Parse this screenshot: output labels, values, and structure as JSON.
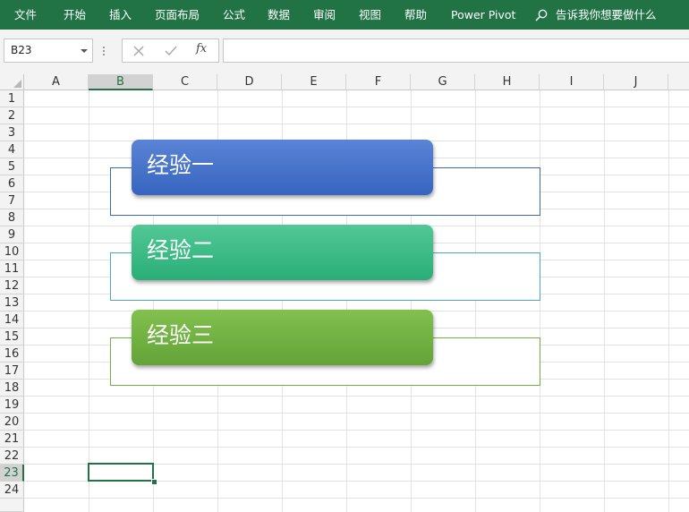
{
  "ribbon": {
    "tabs": [
      "文件",
      "开始",
      "插入",
      "页面布局",
      "公式",
      "数据",
      "审阅",
      "视图",
      "帮助",
      "Power Pivot"
    ],
    "tell_me": "告诉我你想要做什么"
  },
  "formula_bar": {
    "name_box": "B23",
    "cancel_icon": "cancel-icon",
    "enter_icon": "check-icon",
    "function_label": "fx",
    "formula": ""
  },
  "sheet": {
    "columns": [
      "A",
      "B",
      "C",
      "D",
      "E",
      "F",
      "G",
      "H",
      "I",
      "J"
    ],
    "rows": [
      "1",
      "2",
      "3",
      "4",
      "5",
      "6",
      "7",
      "8",
      "9",
      "10",
      "11",
      "12",
      "13",
      "14",
      "15",
      "16",
      "17",
      "18",
      "19",
      "20",
      "21",
      "22",
      "23",
      "24"
    ],
    "selected_column": "B",
    "selected_row": "23"
  },
  "shapes": [
    {
      "label": "经验一",
      "color_top": "#5b84d6",
      "color_bottom": "#3664bf",
      "outline": "#3a6ab0"
    },
    {
      "label": "经验二",
      "color_top": "#52c896",
      "color_bottom": "#2aae78",
      "outline": "#4aa8c0"
    },
    {
      "label": "经验三",
      "color_top": "#82c04e",
      "color_bottom": "#63a338",
      "outline": "#70ad47"
    }
  ],
  "colors": {
    "accent": "#217346"
  }
}
